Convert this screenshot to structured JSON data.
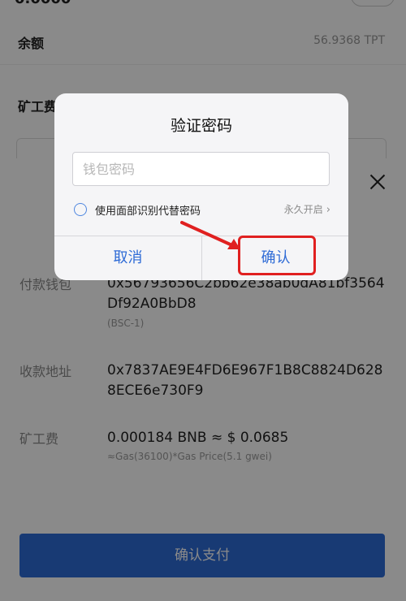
{
  "background": {
    "top_cut_text": "0.0000",
    "balance_label": "余额",
    "balance_value": "56.9368 TPT",
    "fee_label": "矿工费"
  },
  "sheet": {
    "rows": [
      {
        "label": "付款钱包",
        "value": "0x56793656C2bb62e38ab0dA81bf3564Df92A0BbD8",
        "sub": "(BSC-1)"
      },
      {
        "label": "收款地址",
        "value": "0x7837AE9E4FD6E967F1B8C8824D6288ECE6e730F9",
        "sub": ""
      },
      {
        "label": "矿工费",
        "value": "0.000184 BNB ≈ $ 0.0685",
        "sub": "≈Gas(36100)*Gas Price(5.1 gwei)"
      }
    ],
    "pay_button_label": "确认支付"
  },
  "dialog": {
    "title": "验证密码",
    "password_placeholder": "钱包密码",
    "password_value": "",
    "face_id_label": "使用面部识别代替密码",
    "face_id_link": "永久开启",
    "cancel_label": "取消",
    "confirm_label": "确认"
  },
  "colors": {
    "accent": "#2e6bd6",
    "highlight": "#e02020",
    "overlay": "rgba(0,0,0,0.46)"
  }
}
